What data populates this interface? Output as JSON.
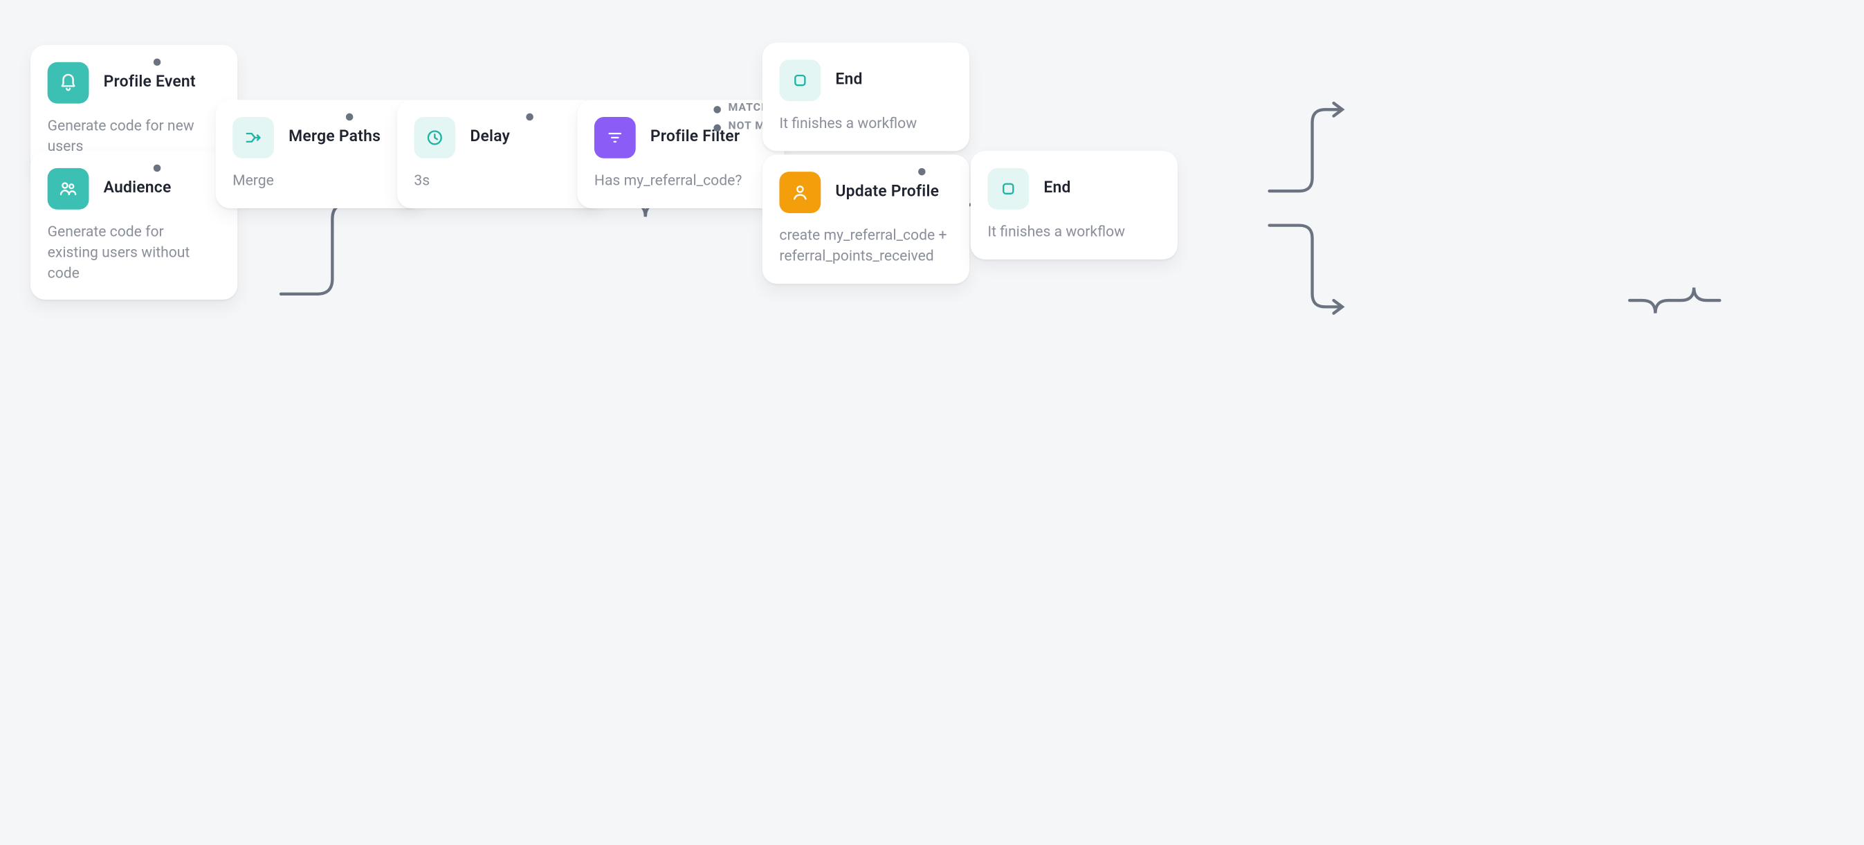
{
  "nodes": {
    "profile_event": {
      "title": "Profile Event",
      "subtitle": "Generate code for new users",
      "icon": "bell-icon"
    },
    "audience": {
      "title": "Audience",
      "subtitle": "Generate code for existing users without code",
      "icon": "users-icon"
    },
    "merge": {
      "title": "Merge Paths",
      "subtitle": "Merge",
      "icon": "merge-icon"
    },
    "delay": {
      "title": "Delay",
      "subtitle": "3s",
      "icon": "clock-icon"
    },
    "filter": {
      "title": "Profile Filter",
      "subtitle": "Has my_referral_code?",
      "icon": "filter-icon"
    },
    "end_top": {
      "title": "End",
      "subtitle": "It finishes a workflow",
      "icon": "stop-icon"
    },
    "update": {
      "title": "Update Profile",
      "subtitle": "create my_referral_code + referral_points_received",
      "icon": "update-icon"
    },
    "end_bottom": {
      "title": "End",
      "subtitle": "It finishes a workflow",
      "icon": "stop-icon"
    }
  },
  "branches": {
    "matched": "MATCHED",
    "not_matched": "NOT MATCHED"
  },
  "colors": {
    "teal": "#3cc0b3",
    "purple": "#8b5cf6",
    "orange": "#f59e0b"
  }
}
